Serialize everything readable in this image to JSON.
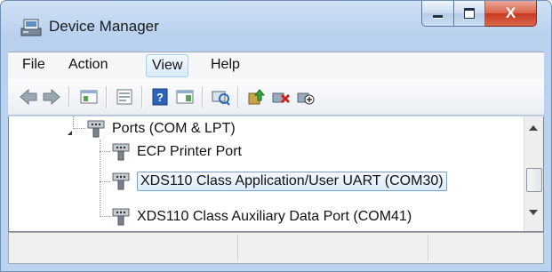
{
  "window": {
    "title": "Device Manager",
    "close_glyph": "X"
  },
  "menu": {
    "items": [
      "File",
      "Action",
      "View",
      "Help"
    ],
    "highlighted": "View"
  },
  "toolbar": {
    "buttons": [
      "back-arrow-icon",
      "forward-arrow-icon",
      "show-hide-console-tree-icon",
      "properties-icon",
      "help-icon",
      "show-action-pane-icon",
      "scan-hardware-changes-icon",
      "update-driver-icon",
      "uninstall-device-icon",
      "disable-device-icon"
    ]
  },
  "tree": {
    "category": "Ports (COM & LPT)",
    "items": [
      "ECP Printer Port",
      "XDS110 Class Application/User UART (COM30)",
      "XDS110 Class Auxiliary Data Port (COM41)"
    ],
    "selected_index": 1
  },
  "status": {
    "panes": [
      "",
      "",
      ""
    ]
  },
  "colors": {
    "title_bar": "#bcd3ef",
    "close_button": "#c7381e",
    "selection": "#dcebfc"
  }
}
